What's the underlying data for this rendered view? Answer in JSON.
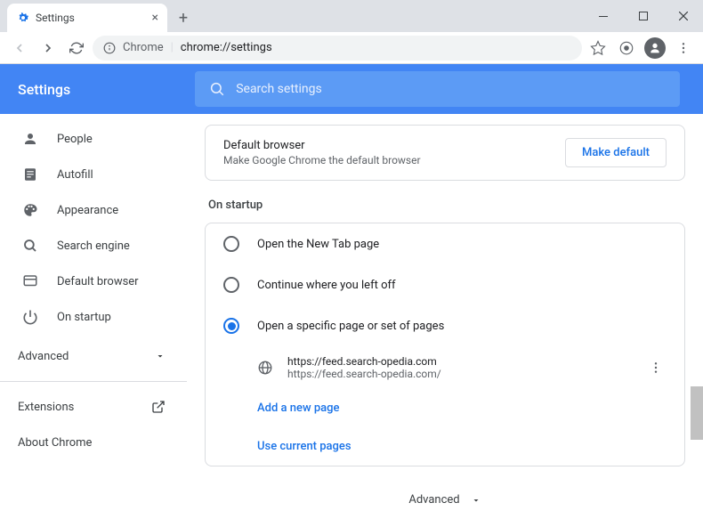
{
  "window": {
    "tab_title": "Settings",
    "omnibox_prefix": "Chrome",
    "omnibox_url": "chrome://settings"
  },
  "header": {
    "title": "Settings",
    "search_placeholder": "Search settings"
  },
  "sidebar": {
    "items": [
      {
        "label": "People"
      },
      {
        "label": "Autofill"
      },
      {
        "label": "Appearance"
      },
      {
        "label": "Search engine"
      },
      {
        "label": "Default browser"
      },
      {
        "label": "On startup"
      }
    ],
    "advanced": "Advanced",
    "extensions": "Extensions",
    "about": "About Chrome"
  },
  "default_browser": {
    "title": "Default browser",
    "subtitle": "Make Google Chrome the default browser",
    "button": "Make default"
  },
  "startup": {
    "section_title": "On startup",
    "options": [
      {
        "label": "Open the New Tab page"
      },
      {
        "label": "Continue where you left off"
      },
      {
        "label": "Open a specific page or set of pages"
      }
    ],
    "page": {
      "url_display": "https://feed.search-opedia.com",
      "url_full": "https://feed.search-opedia.com/"
    },
    "add_page": "Add a new page",
    "use_current": "Use current pages"
  },
  "footer": {
    "advanced": "Advanced"
  }
}
